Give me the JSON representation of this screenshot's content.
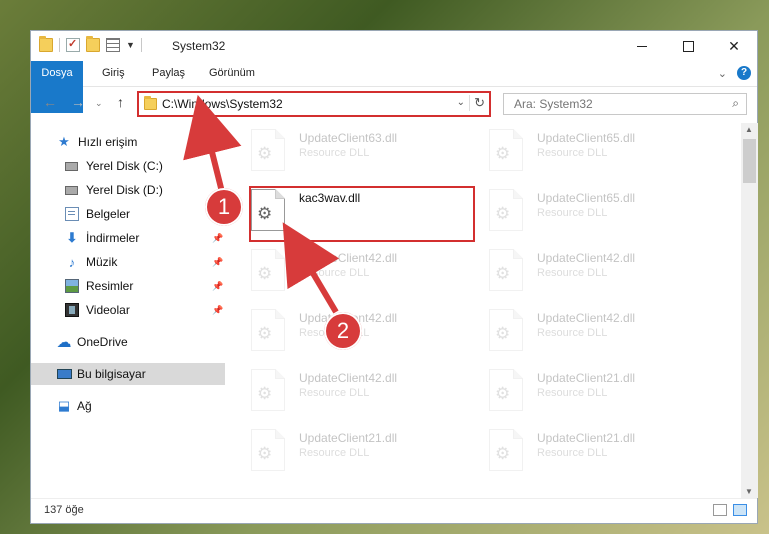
{
  "window": {
    "title": "System32",
    "controls": {
      "minimize": "—",
      "maximize": "☐",
      "close": "✕"
    }
  },
  "ribbon": {
    "tabs": [
      {
        "label": "Dosya"
      },
      {
        "label": "Giriş"
      },
      {
        "label": "Paylaş"
      },
      {
        "label": "Görünüm"
      }
    ],
    "help_label": "?"
  },
  "nav": {
    "address_path": "C:\\Windows\\System32",
    "search_placeholder": "Ara: System32"
  },
  "sidebar": {
    "items": [
      {
        "label": "Hızlı erişim",
        "icon": "star-icon"
      },
      {
        "label": "Yerel Disk (C:)",
        "icon": "disk-icon"
      },
      {
        "label": "Yerel Disk (D:)",
        "icon": "disk-icon"
      },
      {
        "label": "Belgeler",
        "icon": "documents-icon"
      },
      {
        "label": "İndirmeler",
        "icon": "download-icon"
      },
      {
        "label": "Müzik",
        "icon": "music-icon"
      },
      {
        "label": "Resimler",
        "icon": "pictures-icon"
      },
      {
        "label": "Videolar",
        "icon": "videos-icon"
      },
      {
        "label": "OneDrive",
        "icon": "cloud-icon"
      },
      {
        "label": "Bu bilgisayar",
        "icon": "computer-icon",
        "selected": true
      },
      {
        "label": "Ağ",
        "icon": "network-icon"
      }
    ]
  },
  "files": {
    "col1": [
      {
        "name": "UpdateClient63.dll",
        "type": "Resource DLL"
      },
      {
        "name": "kac3wav.dll",
        "type": ""
      },
      {
        "name": "UpdateClient42.dll",
        "type": "Resource DLL"
      },
      {
        "name": "UpdateClient42.dll",
        "type": "Resource DLL"
      },
      {
        "name": "UpdateClient42.dll",
        "type": "Resource DLL"
      },
      {
        "name": "UpdateClient21.dll",
        "type": "Resource DLL"
      }
    ],
    "col2": [
      {
        "name": "UpdateClient65.dll",
        "type": "Resource DLL"
      },
      {
        "name": "UpdateClient65.dll",
        "type": "Resource DLL"
      },
      {
        "name": "UpdateClient42.dll",
        "type": "Resource DLL"
      },
      {
        "name": "UpdateClient42.dll",
        "type": "Resource DLL"
      },
      {
        "name": "UpdateClient21.dll",
        "type": "Resource DLL"
      },
      {
        "name": "UpdateClient21.dll",
        "type": "Resource DLL"
      }
    ]
  },
  "status": {
    "item_count": "137 öğe"
  },
  "annotations": {
    "marker1": "1",
    "marker2": "2",
    "color": "#d73b3b"
  }
}
